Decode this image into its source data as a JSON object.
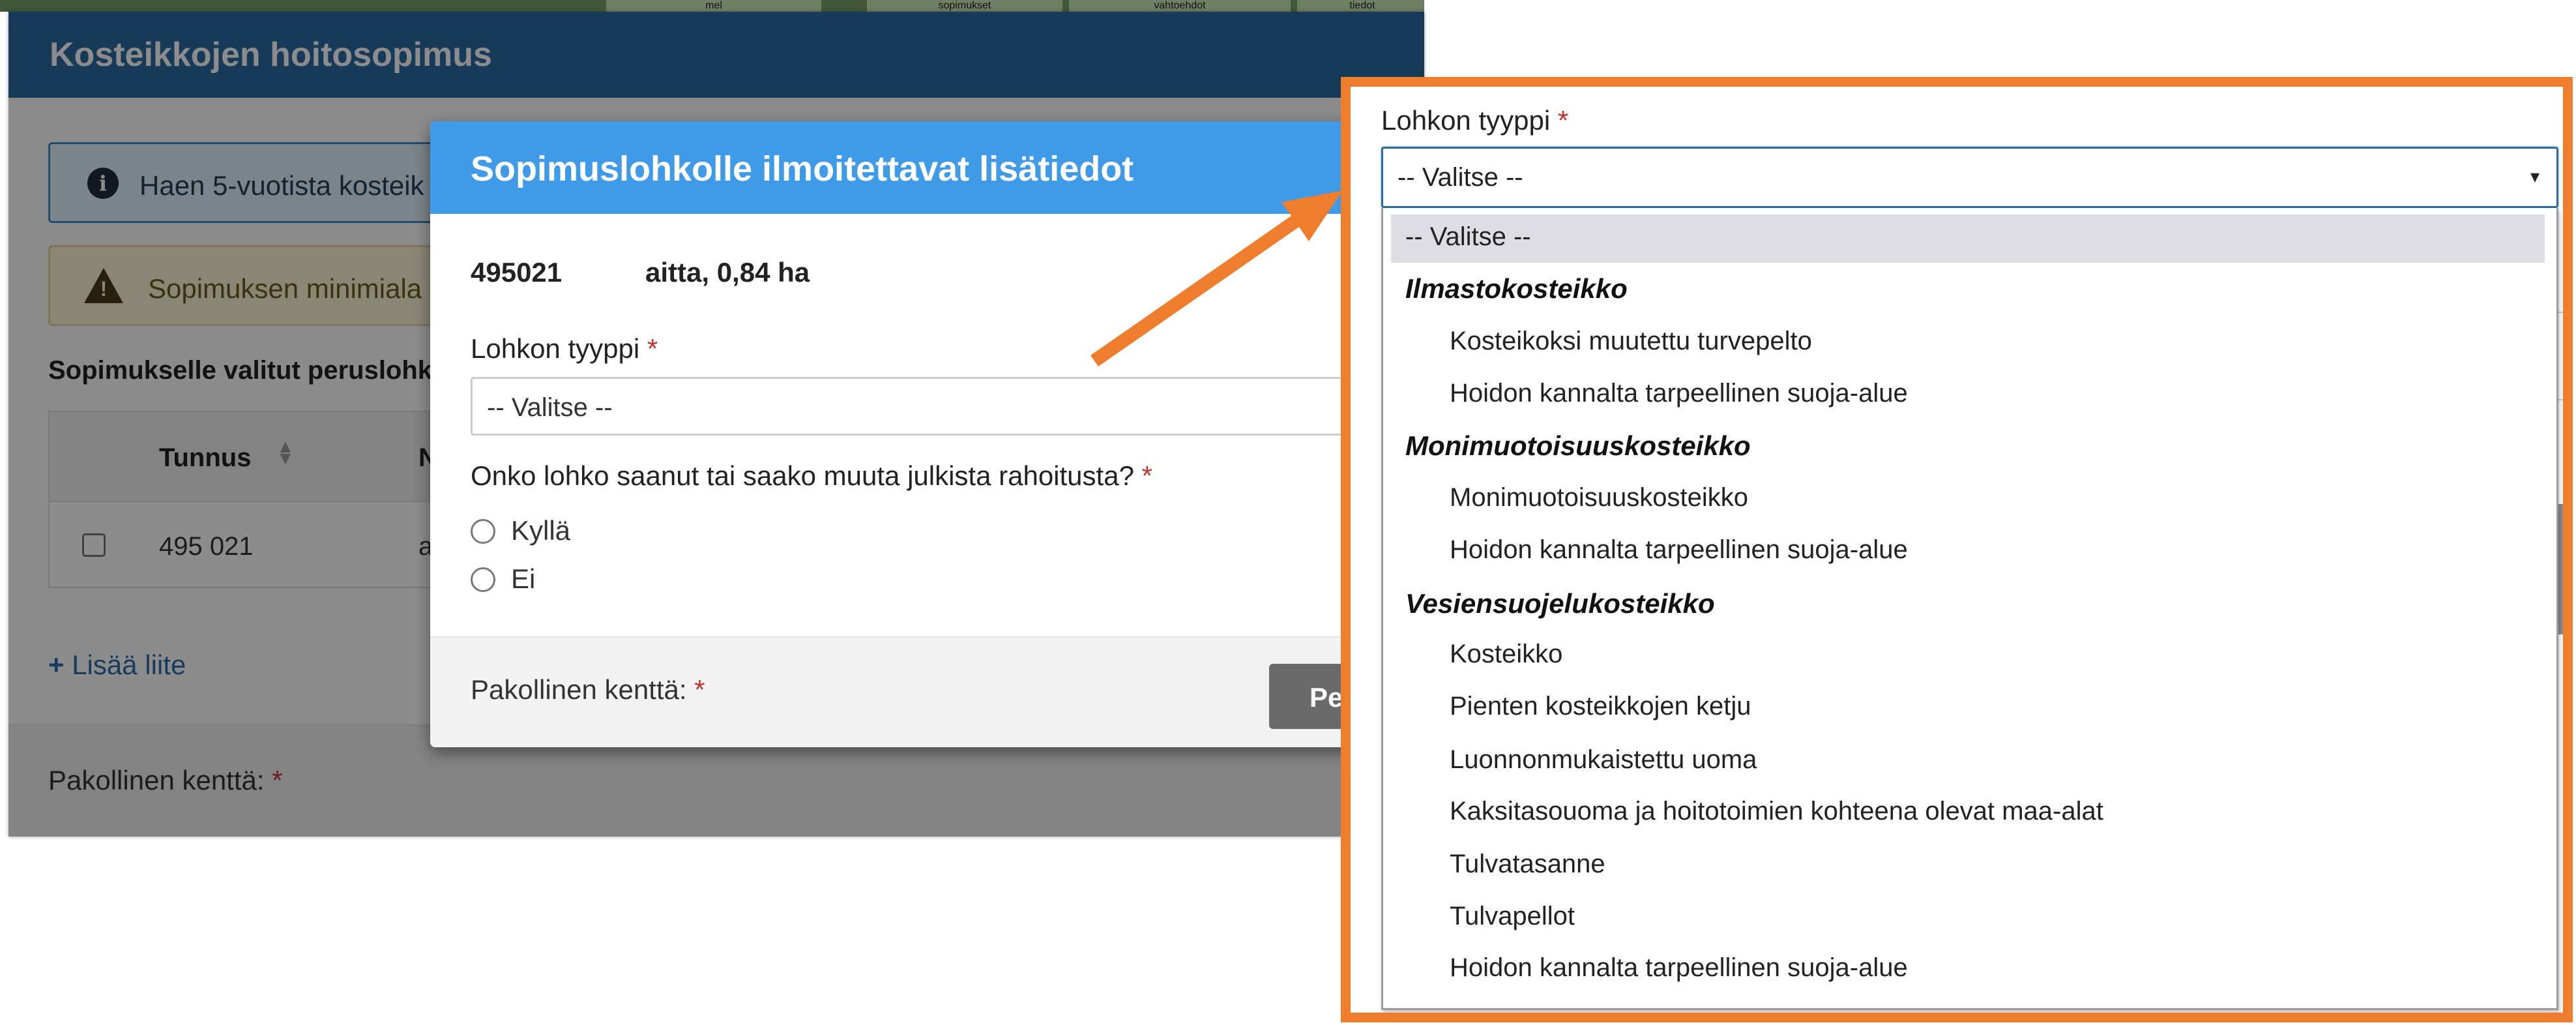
{
  "background": {
    "tab_labels": [
      "mel",
      "sopimukset",
      "vahtoehdot",
      "tiedot"
    ],
    "window_title": "Kosteikkojen hoitosopimus",
    "info_text": "Haen 5-vuotista kosteik",
    "warning_text": "Sopimuksen minimiala",
    "section_heading": "Sopimukselle valitut peruslohk",
    "table": {
      "columns": [
        "Tunnus",
        "N"
      ],
      "rows": [
        {
          "tunnus": "495 021",
          "name": "a"
        }
      ]
    },
    "add_attachment": "Lisää liite",
    "required_note": "Pakollinen kenttä:",
    "required_mark": "*"
  },
  "modal": {
    "title": "Sopimuslohkolle ilmoitettavat lisätiedot",
    "parcel_id": "495021",
    "parcel_desc": "aitta, 0,84 ha",
    "type_label": "Lohkon tyyppi",
    "type_value": "-- Valitse --",
    "funding_question": "Onko lohko saanut tai saako muuta julkista rahoitusta?",
    "options": [
      "Kyllä",
      "Ei"
    ],
    "required_note": "Pakollinen kenttä:",
    "button_label": "Pe",
    "required_mark": "*"
  },
  "zoom": {
    "label": "Lohkon tyyppi",
    "required_mark": "*",
    "select_value": "-- Valitse --",
    "caret": "▾",
    "placeholder_option": "-- Valitse --",
    "groups": [
      {
        "name": "Ilmastokosteikko",
        "options": [
          "Kosteikoksi muutettu turvepelto",
          "Hoidon kannalta tarpeellinen suoja-alue"
        ]
      },
      {
        "name": "Monimuotoisuuskosteikko",
        "options": [
          "Monimuotoisuuskosteikko",
          "Hoidon kannalta tarpeellinen suoja-alue"
        ]
      },
      {
        "name": "Vesiensuojelukosteikko",
        "options": [
          "Kosteikko",
          "Pienten kosteikkojen ketju",
          "Luonnonmukaistettu uoma",
          "Kaksitasouoma ja hoitotoimien kohteena olevat maa-alat",
          "Tulvatasanne",
          "Tulvapellot",
          "Hoidon kannalta tarpeellinen suoja-alue"
        ]
      }
    ]
  },
  "colors": {
    "highlight_frame": "#ee7d2e",
    "modal_header": "#3f9ae8",
    "window_header": "#2b6aa3",
    "required": "#c9302c"
  },
  "icons": {
    "info": "info-icon",
    "warning": "warning-icon",
    "sort": "sort-icon",
    "plus": "plus-icon",
    "caret": "chevron-down-icon",
    "arrow": "callout-arrow-icon"
  }
}
